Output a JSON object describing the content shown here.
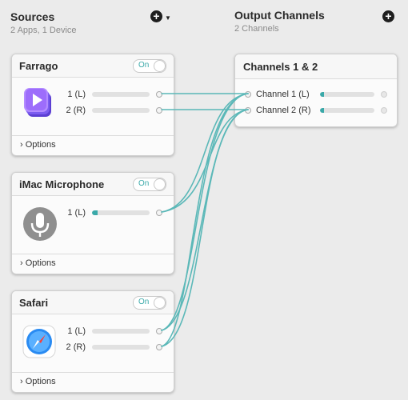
{
  "sources": {
    "title": "Sources",
    "subtitle": "2 Apps, 1 Device",
    "add_icon": "plus-circle-icon",
    "caret_icon": "chevron-down-icon"
  },
  "outputs": {
    "title": "Output Channels",
    "subtitle": "2 Channels",
    "add_icon": "plus-circle-icon"
  },
  "cards": [
    {
      "title": "Farrago",
      "toggle": "On",
      "icon": "farrago-app-icon",
      "channels": [
        {
          "label": "1 (L)",
          "level": 0.0
        },
        {
          "label": "2 (R)",
          "level": 0.0
        }
      ],
      "options": "Options"
    },
    {
      "title": "iMac Microphone",
      "toggle": "On",
      "icon": "microphone-icon",
      "channels": [
        {
          "label": "1 (L)",
          "level": 0.1
        }
      ],
      "options": "Options"
    },
    {
      "title": "Safari",
      "toggle": "On",
      "icon": "safari-compass-icon",
      "channels": [
        {
          "label": "1 (L)",
          "level": 0.0
        },
        {
          "label": "2 (R)",
          "level": 0.0
        }
      ],
      "options": "Options"
    }
  ],
  "output_card": {
    "title": "Channels 1 & 2",
    "channels": [
      {
        "label": "Channel 1 (L)",
        "level": 0.08
      },
      {
        "label": "Channel 2 (R)",
        "level": 0.08
      }
    ]
  },
  "colors": {
    "accent": "#3aa9a9",
    "wire": "#5bb8b8"
  }
}
